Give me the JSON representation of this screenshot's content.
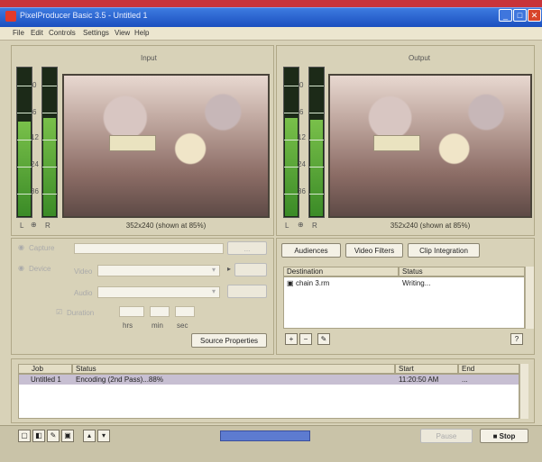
{
  "window": {
    "title": "PixelProducer Basic 3.5 - Untitled 1"
  },
  "menu": [
    "File",
    "Edit",
    "Controls",
    "Settings",
    "View",
    "Help"
  ],
  "input": {
    "label": "Input",
    "meter_left": "L",
    "meter_right": "R",
    "meter_scale": [
      "0",
      "6",
      "12",
      "24",
      "36"
    ],
    "caption": "352x240 (shown at 85%)"
  },
  "output": {
    "label": "Output",
    "meter_left": "L",
    "meter_right": "R",
    "meter_scale": [
      "0",
      "6",
      "12",
      "24",
      "36"
    ],
    "caption": "352x240 (shown at 85%)"
  },
  "source": {
    "file_label": "Capture",
    "device_label": "Device",
    "video_label": "Video",
    "audio_label": "Audio",
    "duration_label": "Duration",
    "units": [
      "hrs",
      "min",
      "sec"
    ],
    "properties_button": "Source Properties"
  },
  "output_tabs": [
    "Audiences",
    "Video Filters",
    "Clip Integration"
  ],
  "destination_table": {
    "headers": [
      "Destination",
      "Status"
    ],
    "rows": [
      {
        "destination": "chain 3.rm",
        "status": "Writing..."
      }
    ]
  },
  "jobs_table": {
    "headers": [
      "Job",
      "Status",
      "Start",
      "End"
    ],
    "rows": [
      {
        "job": "Untitled 1",
        "status": "Encoding (2nd Pass)...88%",
        "start": "11:20:50 AM",
        "end": "..."
      }
    ]
  },
  "bottom": {
    "pause_label": "Pause",
    "stop_label": "Stop"
  }
}
